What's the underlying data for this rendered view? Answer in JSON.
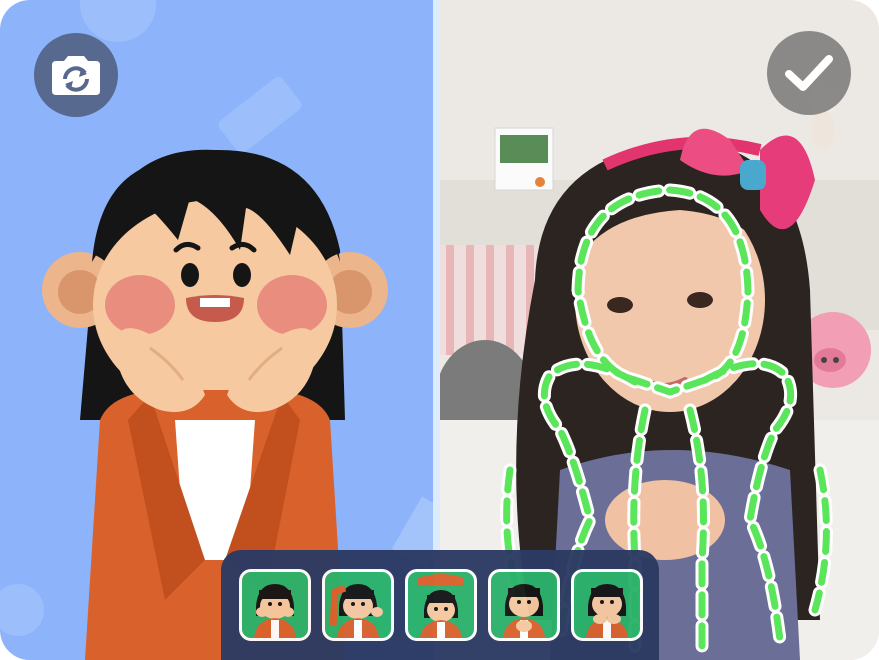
{
  "app": {
    "switch_camera_button": {
      "icon": "camera-switch-icon"
    },
    "confirm_button": {
      "icon": "checkmark-icon"
    }
  },
  "left_panel": {
    "background_color": "#8db4fb",
    "illustration": "cartoon-girl-hands-on-cheeks"
  },
  "right_panel": {
    "photo": "camera-preview-girl-with-pink-bow",
    "pose_guide_color": "#5be55b"
  },
  "pose_tray": {
    "background_color": "#2c3a63",
    "thumb_background": "#2bb26b",
    "poses": [
      {
        "id": "pose-1",
        "icon": "hands-on-cheeks-pose-icon"
      },
      {
        "id": "pose-2",
        "icon": "hand-on-head-pose-icon"
      },
      {
        "id": "pose-3",
        "icon": "arms-over-head-pose-icon"
      },
      {
        "id": "pose-4",
        "icon": "hands-together-pose-icon"
      },
      {
        "id": "pose-5",
        "icon": "chin-rest-pose-icon"
      }
    ]
  }
}
